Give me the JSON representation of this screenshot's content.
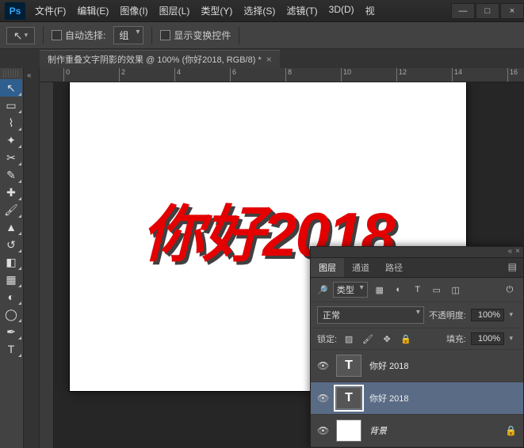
{
  "app": {
    "logo": "Ps"
  },
  "menu": [
    "文件(F)",
    "编辑(E)",
    "图像(I)",
    "图层(L)",
    "类型(Y)",
    "选择(S)",
    "滤镜(T)",
    "3D(D)",
    "视"
  ],
  "win": {
    "min": "—",
    "max": "□",
    "close": "×"
  },
  "options": {
    "auto_select": "自动选择:",
    "group": "组",
    "show_transform": "显示变换控件"
  },
  "tab": {
    "title": "制作重叠文字阴影的效果 @ 100% (你好2018, RGB/8) *",
    "close": "×"
  },
  "ruler": {
    "ticks": [
      "0",
      "2",
      "4",
      "6",
      "8",
      "10",
      "12",
      "14",
      "16"
    ]
  },
  "canvas": {
    "text": "你好2018"
  },
  "panel": {
    "tabs": {
      "layers": "图层",
      "channels": "通道",
      "paths": "路径"
    },
    "kind_label": "类型",
    "blend": "正常",
    "opacity_lbl": "不透明度:",
    "opacity_val": "100%",
    "lock_lbl": "锁定:",
    "fill_lbl": "填充:",
    "fill_val": "100%",
    "layers": [
      {
        "name": "你好 2018",
        "type": "T"
      },
      {
        "name": "你好 2018",
        "type": "T"
      },
      {
        "name": "背景",
        "type": "bg"
      }
    ]
  }
}
